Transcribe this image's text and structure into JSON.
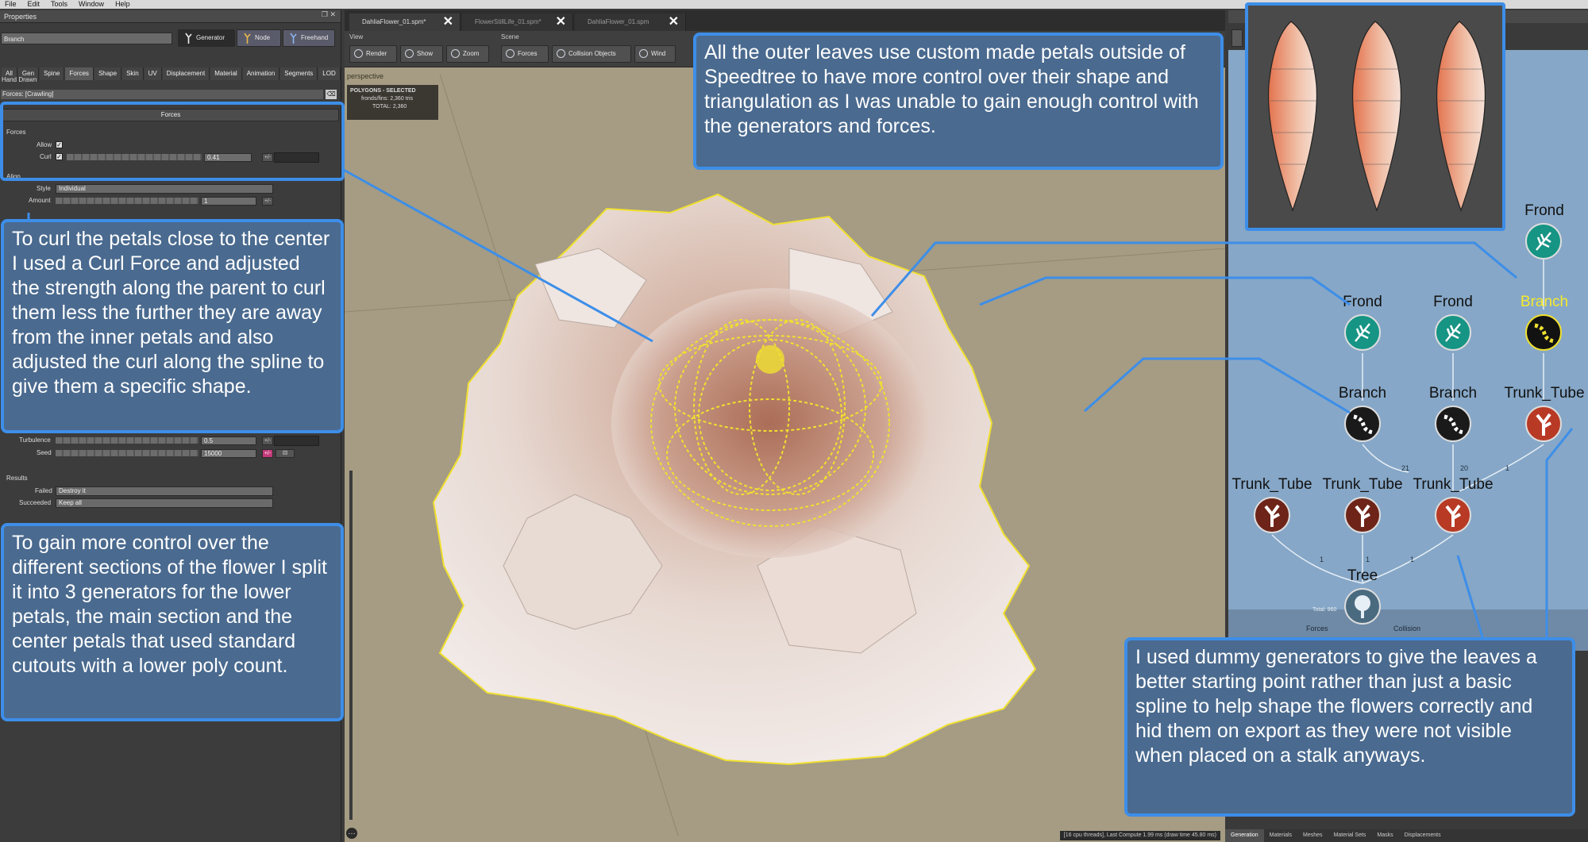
{
  "menu": [
    "File",
    "Edit",
    "Tools",
    "Window",
    "Help"
  ],
  "properties": {
    "title": "Properties",
    "name_value": "Branch",
    "modes": [
      "Generator",
      "Node",
      "Freehand"
    ],
    "tabs": [
      "All",
      "Gen",
      "Spine",
      "Forces",
      "Shape",
      "Skin",
      "UV",
      "Displacement",
      "Material",
      "Animation",
      "Segments",
      "LOD"
    ],
    "hand_drawn": "Hand Drawn",
    "forces_label": "Forces: [Crawling]",
    "section": "Forces",
    "group_forces": "Forces",
    "allow_label": "Allow",
    "curl_label": "Curl",
    "curl_value": "0.41",
    "align_label": "Align",
    "style_label": "Style",
    "style_value": "Individual",
    "amount_label": "Amount",
    "amount_value": "1",
    "turbulence_label": "Turbulence",
    "turbulence_value": "0.5",
    "seed_label": "Seed",
    "seed_value": "15000",
    "results_label": "Results",
    "failed_label": "Failed",
    "failed_value": "Destroy it",
    "succeeded_label": "Succeeded",
    "succeeded_value": "Keep all"
  },
  "viewport": {
    "tabs": [
      "DahliaFlower_01.spm*",
      "FlowerStillLife_01.spm*",
      "DahliaFlower_01.spm"
    ],
    "view_label": "View",
    "scene_label": "Scene",
    "view_buttons": [
      "Render",
      "Show",
      "Zoom"
    ],
    "scene_buttons": [
      "Forces",
      "Collision Objects",
      "Wind"
    ],
    "perspective": "perspective",
    "poly_title": "POLYGONS - SELECTED",
    "poly_row1_label": "fronds/fins:",
    "poly_row1_value": "2,360 tris",
    "poly_row2_label": "TOTAL:",
    "poly_row2_value": "2,360",
    "status": "[16 cpu threads], Last Compute 1.99 ms (draw time 45.80 ms)"
  },
  "graph": {
    "nodes": [
      {
        "label": "Frond",
        "kind": "teal"
      },
      {
        "label": "Frond",
        "kind": "teal"
      },
      {
        "label": "Frond",
        "kind": "teal"
      },
      {
        "label": "Branch",
        "kind": "yellow"
      },
      {
        "label": "Branch",
        "kind": "dark"
      },
      {
        "label": "Branch",
        "kind": "dark"
      },
      {
        "label": "Trunk_Tube",
        "kind": "red"
      },
      {
        "label": "Trunk_Tube",
        "kind": "darkred"
      },
      {
        "label": "Trunk_Tube",
        "kind": "darkred"
      },
      {
        "label": "Trunk_Tube",
        "kind": "red"
      },
      {
        "label": "Tree",
        "kind": "tree"
      }
    ],
    "port_labels": [
      "21",
      "20",
      "1",
      "1",
      "1",
      "1"
    ],
    "bottom_labels": [
      "Forces",
      "Collision"
    ],
    "total_label": "Total: 960",
    "tabs": [
      "Generation",
      "Materials",
      "Meshes",
      "Material Sets",
      "Masks",
      "Displacements"
    ]
  },
  "notes": {
    "top": "All the outer leaves use custom made petals outside of Speedtree to have more control over their shape and triangulation as I was unable to gain enough control with the generators and forces.",
    "left1": "To curl the petals close to the center I used a Curl Force and adjusted the strength along the parent to curl them less the further they are away from the inner petals and also adjusted the curl along the spline to give them a specific shape.",
    "left2": "To gain more control over the different sections of the flower I split it into 3 generators for the lower petals, the main section and the center petals that used standard cutouts with a lower poly count.",
    "right": "I used dummy generators to give the leaves a better starting point rather than just a basic spline to help shape the flowers correctly and hid them on export as they were not visible when placed on a stalk anyways."
  },
  "colors": {
    "callout_border": "#3d8ee8",
    "callout_fill": "#4a6a8f",
    "selection_yellow": "#f0e030",
    "graph_bg": "#86a7c7",
    "viewport_bg": "#a59c83"
  }
}
